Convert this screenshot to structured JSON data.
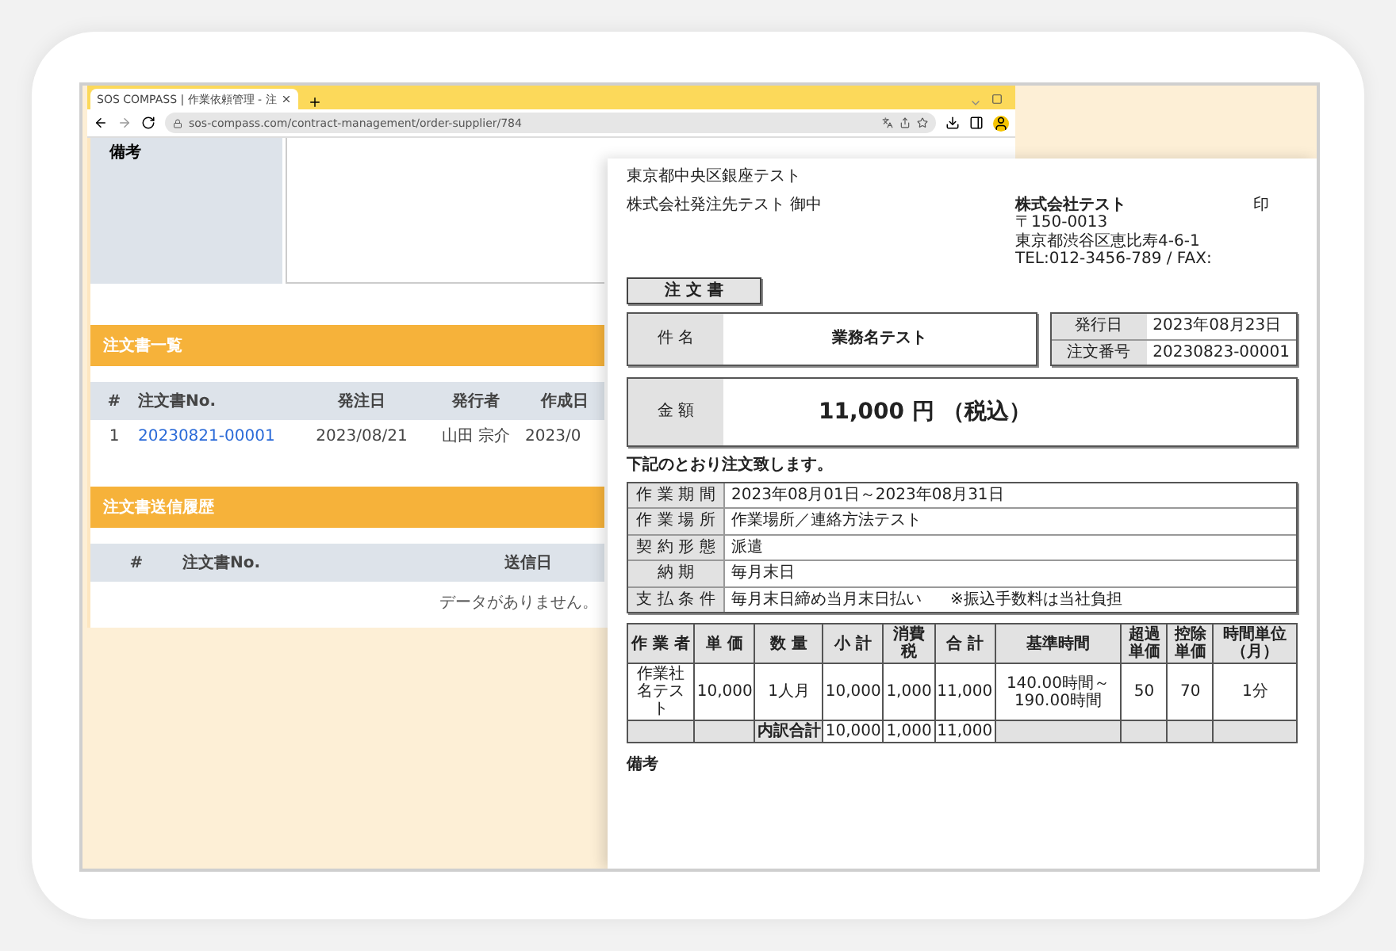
{
  "browser": {
    "tab_title": "SOS COMPASS | 作業依頼管理 - 注",
    "address": "sos-compass.com/contract-management/order-supplier/784"
  },
  "page": {
    "remarks_label": "備考",
    "sections": [
      {
        "title": "注文書一覧",
        "columns": [
          "#",
          "注文書No.",
          "発注日",
          "発行者",
          "作成日"
        ],
        "rows": [
          {
            "cells": [
              "1",
              "20230821-00001",
              "2023/08/21",
              "山田 宗介",
              "2023/0"
            ]
          }
        ]
      },
      {
        "title": "注文書送信履歴",
        "columns": [
          "#",
          "注文書No.",
          "送信日"
        ],
        "empty_message": "データがありません。"
      }
    ]
  },
  "document": {
    "address_line": "東京都中央区銀座テスト",
    "recipient": "株式会社発注先テスト 御中",
    "issuer": {
      "name": "株式会社テスト",
      "lines": [
        "〒150-0013",
        "東京都渋谷区恵比寿4-6-1",
        "TEL:012-3456-789 / FAX:"
      ]
    },
    "seal": "印",
    "title": "注 文 書",
    "subject_label": "件 名",
    "subject": "業務名テスト",
    "meta": [
      {
        "label": "発行日",
        "value": "2023年08月23日"
      },
      {
        "label": "注文番号",
        "value": "20230823-00001"
      }
    ],
    "amount_label": "金 額",
    "amount": "11,000 円 （税込）",
    "intro": "下記のとおり注文致します。",
    "terms": [
      {
        "label": "作 業 期 間",
        "value": "2023年08月01日～2023年08月31日"
      },
      {
        "label": "作 業 場 所",
        "value": "作業場所／連絡方法テスト"
      },
      {
        "label": "契 約 形 態",
        "value": "派遣"
      },
      {
        "label": "納 期",
        "value": "毎月末日"
      },
      {
        "label": "支 払 条 件",
        "value": "毎月末日締め当月末日払い",
        "note": "※振込手数料は当社負担"
      }
    ],
    "items": {
      "columns": [
        "作 業 者",
        "単 価",
        "数 量",
        "小 計",
        "消費税",
        "合 計",
        "基準時間",
        "超過単価",
        "控除単価",
        "時間単位（月）"
      ],
      "rows": [
        {
          "cells": [
            "作業社名テスト",
            "10,000",
            "1人月",
            "10,000",
            "1,000",
            "11,000",
            "140.00時間～190.00時間",
            "50",
            "70",
            "1分"
          ]
        }
      ],
      "totals": {
        "label": "内訳合計",
        "values": [
          "10,000",
          "1,000",
          "11,000"
        ]
      }
    },
    "remarks_label": "備考"
  }
}
